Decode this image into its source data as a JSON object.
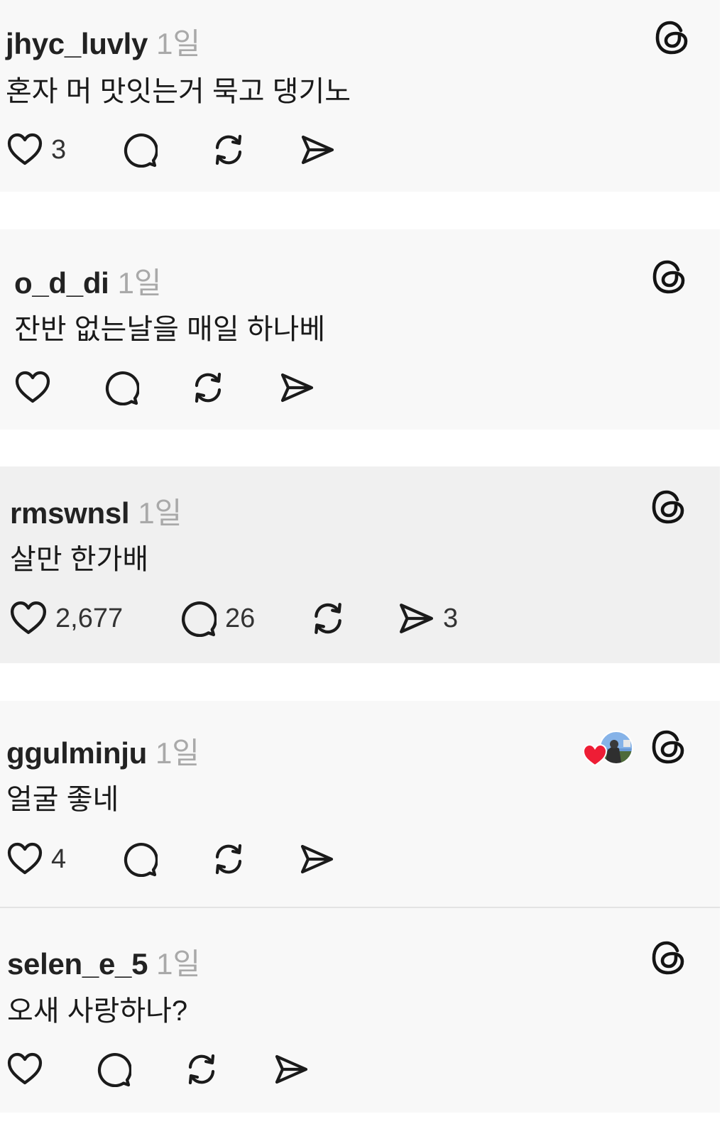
{
  "comments": [
    {
      "username": "jhyc_luvly",
      "time": "1일",
      "text": "혼자 머 맛잇는거 묵고 댕기노",
      "likes": "3",
      "replies": "",
      "reposts": "",
      "shares": ""
    },
    {
      "username": "o_d_di",
      "time": "1일",
      "text": "잔반 없는날을 매일 하나베",
      "likes": "",
      "replies": "",
      "reposts": "",
      "shares": ""
    },
    {
      "username": "rmswnsl",
      "time": "1일",
      "text": "살만 한가배",
      "likes": "2,677",
      "replies": "26",
      "reposts": "",
      "shares": "3"
    },
    {
      "username": "ggulminju",
      "time": "1일",
      "text": "얼굴 좋네",
      "likes": "4",
      "replies": "",
      "reposts": "",
      "shares": "",
      "liked_by_author": true
    },
    {
      "username": "selen_e_5",
      "time": "1일",
      "text": "오새 사랑하나?",
      "likes": "",
      "replies": "",
      "reposts": "",
      "shares": ""
    }
  ],
  "icons": {
    "like": "heart-icon",
    "reply": "comment-bubble-icon",
    "repost": "repost-icon",
    "share": "send-icon",
    "app": "threads-logo-icon",
    "liked_badge": "red-heart-icon"
  },
  "colors": {
    "card_bg": "#f8f8f8",
    "highlight_bg": "#f0f0f0",
    "username": "#222222",
    "timestamp": "#a9a9a9",
    "like_badge": "#ee1d35"
  }
}
